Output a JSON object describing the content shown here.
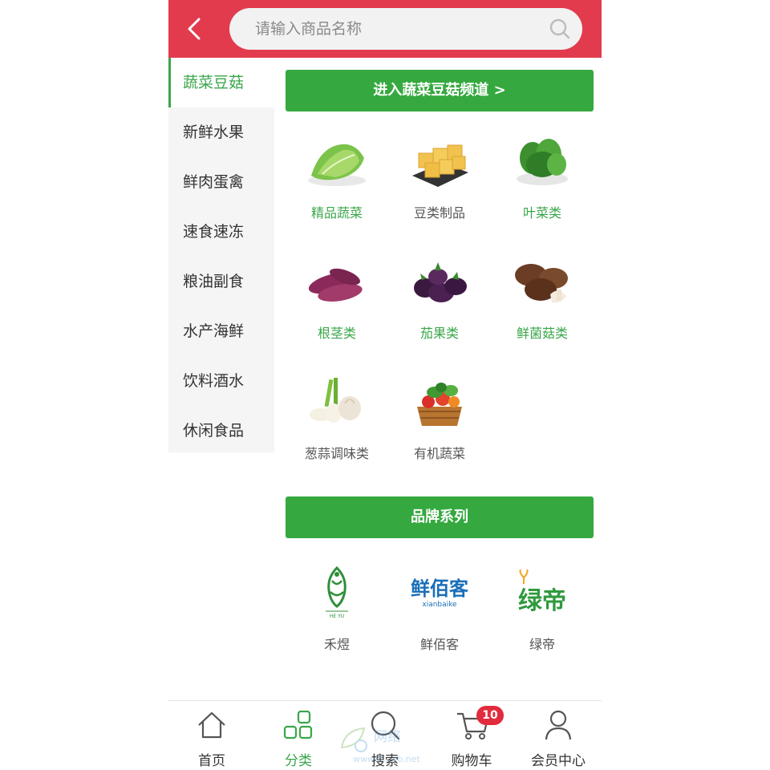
{
  "header": {
    "search_placeholder": "请输入商品名称"
  },
  "sidebar": {
    "items": [
      {
        "label": "蔬菜豆菇",
        "active": true
      },
      {
        "label": "新鲜水果",
        "active": false
      },
      {
        "label": "鲜肉蛋禽",
        "active": false
      },
      {
        "label": "速食速冻",
        "active": false
      },
      {
        "label": "粮油副食",
        "active": false
      },
      {
        "label": "水产海鲜",
        "active": false
      },
      {
        "label": "饮料酒水",
        "active": false
      },
      {
        "label": "休闲食品",
        "active": false
      }
    ]
  },
  "main": {
    "channel_button": "进入蔬菜豆菇频道 >",
    "categories": [
      {
        "label": "精品蔬菜",
        "icon": "lettuce-image"
      },
      {
        "label": "豆类制品",
        "icon": "tofu-image"
      },
      {
        "label": "叶菜类",
        "icon": "leafy-greens-image"
      },
      {
        "label": "根茎类",
        "icon": "sweet-potato-image"
      },
      {
        "label": "茄果类",
        "icon": "eggplant-image"
      },
      {
        "label": "鲜菌菇类",
        "icon": "mushroom-image"
      },
      {
        "label": "葱蒜调味类",
        "icon": "garlic-scallion-image"
      },
      {
        "label": "有机蔬菜",
        "icon": "vegetable-basket-image"
      }
    ],
    "brand_title": "品牌系列",
    "brands": [
      {
        "label": "禾煜",
        "logo_text": "HE YU"
      },
      {
        "label": "鲜佰客",
        "logo_text": "鲜佰客",
        "logo_sub": "xianbaike"
      },
      {
        "label": "绿帝",
        "logo_text": "绿帝"
      }
    ]
  },
  "tabbar": {
    "items": [
      {
        "label": "首页",
        "icon": "home-icon"
      },
      {
        "label": "分类",
        "icon": "grid-icon"
      },
      {
        "label": "搜索",
        "icon": "search-icon"
      },
      {
        "label": "购物车",
        "icon": "cart-icon"
      },
      {
        "label": "会员中心",
        "icon": "user-icon"
      }
    ],
    "cart_badge": "10",
    "active": "分类"
  },
  "watermark": {
    "text": "网络",
    "sub": "www.D...eb.net"
  },
  "colors": {
    "header_red": "#e23b4e",
    "green": "#35a93f",
    "badge_red": "#e22b3d"
  }
}
